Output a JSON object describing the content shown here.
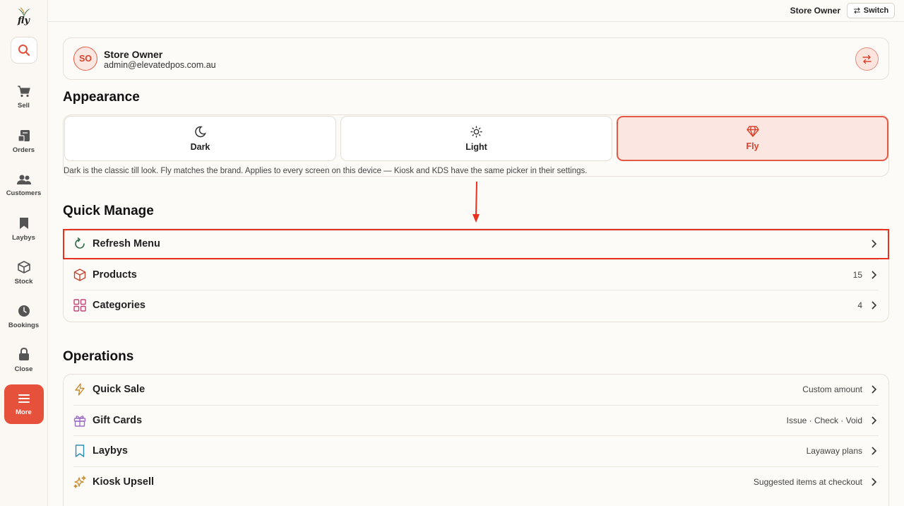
{
  "sidebar": {
    "logo_text": "fly",
    "items": [
      {
        "label": "Sell",
        "icon": "cart-icon"
      },
      {
        "label": "Orders",
        "icon": "orders-icon"
      },
      {
        "label": "Customers",
        "icon": "customers-icon"
      },
      {
        "label": "Laybys",
        "icon": "bookmark-icon"
      },
      {
        "label": "Stock",
        "icon": "box-icon"
      },
      {
        "label": "Bookings",
        "icon": "clock-icon"
      },
      {
        "label": "Close",
        "icon": "lock-icon"
      },
      {
        "label": "More",
        "icon": "menu-icon",
        "active": true
      }
    ]
  },
  "topbar": {
    "user_label": "Store Owner",
    "switch_label": "Switch"
  },
  "profile": {
    "initials": "SO",
    "name": "Store Owner",
    "email": "admin@elevatedpos.com.au"
  },
  "appearance": {
    "title": "Appearance",
    "options": [
      {
        "label": "Dark",
        "icon": "moon-icon"
      },
      {
        "label": "Light",
        "icon": "sun-icon"
      },
      {
        "label": "Fly",
        "icon": "diamond-icon",
        "selected": true
      }
    ],
    "note": "Dark is the classic till look. Fly matches the brand. Applies to every screen on this device — Kiosk and KDS have the same picker in their settings."
  },
  "quick_manage": {
    "title": "Quick Manage",
    "rows": [
      {
        "label": "Refresh Menu",
        "value": "",
        "icon": "refresh-icon"
      },
      {
        "label": "Products",
        "value": "15",
        "icon": "cube-icon"
      },
      {
        "label": "Categories",
        "value": "4",
        "icon": "grid-icon"
      }
    ]
  },
  "operations": {
    "title": "Operations",
    "rows": [
      {
        "label": "Quick Sale",
        "value": "Custom amount",
        "icon": "lightning-icon"
      },
      {
        "label": "Gift Cards",
        "value": "Issue · Check · Void",
        "icon": "gift-icon"
      },
      {
        "label": "Laybys",
        "value": "Layaway plans",
        "icon": "bookmark-icon"
      },
      {
        "label": "Kiosk Upsell",
        "value": "Suggested items at checkout",
        "icon": "sparkles-icon"
      }
    ]
  },
  "colors": {
    "accent": "#e5513b",
    "highlight": "#e8321f",
    "background": "#fdfbf7"
  }
}
